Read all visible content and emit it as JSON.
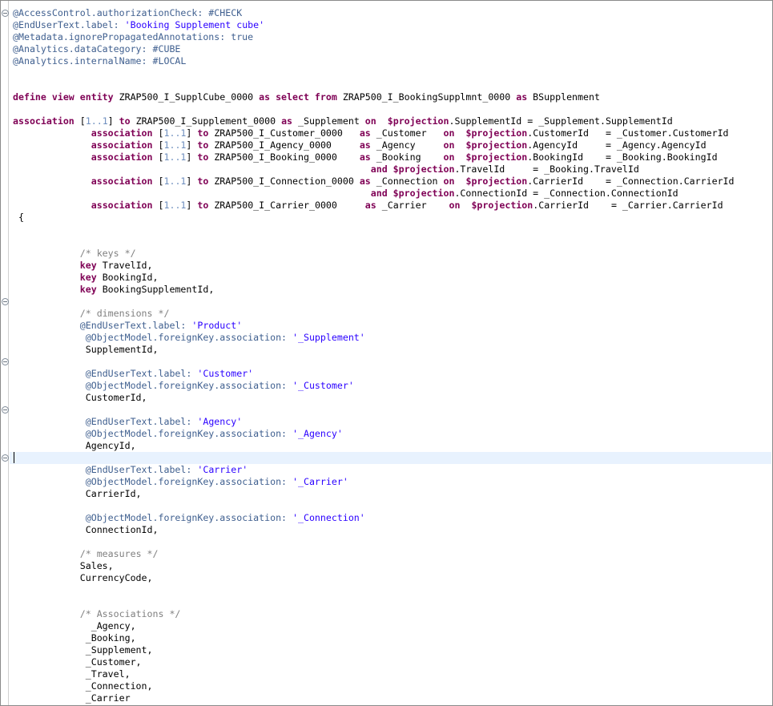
{
  "editor": {
    "language": "ABAP CDS",
    "cursor_line": 38,
    "fold_marker_lines": [
      1,
      25,
      30,
      34,
      38
    ],
    "lines": [
      [
        [
          "anno",
          "@AccessControl.authorizationCheck: #CHECK"
        ]
      ],
      [
        [
          "anno",
          "@EndUserText.label: "
        ],
        [
          "str",
          "'Booking Supplement cube'"
        ]
      ],
      [
        [
          "anno",
          "@Metadata.ignorePropagatedAnnotations: true"
        ]
      ],
      [
        [
          "anno",
          "@Analytics.dataCategory: #CUBE"
        ]
      ],
      [
        [
          "anno",
          "@Analytics.internalName: #LOCAL"
        ]
      ],
      [],
      [],
      [
        [
          "kw",
          "define view entity"
        ],
        [
          "plain",
          " ZRAP500_I_SupplCube_0000 "
        ],
        [
          "kw",
          "as select from"
        ],
        [
          "plain",
          " ZRAP500_I_BookingSupplmnt_0000 "
        ],
        [
          "kw",
          "as"
        ],
        [
          "plain",
          " BSupplenment"
        ]
      ],
      [],
      [
        [
          "kw",
          "association"
        ],
        [
          "plain",
          " ["
        ],
        [
          "num",
          "1..1"
        ],
        [
          "plain",
          "] "
        ],
        [
          "kw",
          "to"
        ],
        [
          "plain",
          " ZRAP500_I_Supplement_0000 "
        ],
        [
          "kw",
          "as"
        ],
        [
          "plain",
          " _Supplement "
        ],
        [
          "kw",
          "on"
        ],
        [
          "plain",
          "  "
        ],
        [
          "kw",
          "$projection"
        ],
        [
          "plain",
          ".SupplementId = _Supplement.SupplementId"
        ]
      ],
      [
        [
          "plain",
          "              "
        ],
        [
          "kw",
          "association"
        ],
        [
          "plain",
          " ["
        ],
        [
          "num",
          "1..1"
        ],
        [
          "plain",
          "] "
        ],
        [
          "kw",
          "to"
        ],
        [
          "plain",
          " ZRAP500_I_Customer_0000   "
        ],
        [
          "kw",
          "as"
        ],
        [
          "plain",
          " _Customer   "
        ],
        [
          "kw",
          "on"
        ],
        [
          "plain",
          "  "
        ],
        [
          "kw",
          "$projection"
        ],
        [
          "plain",
          ".CustomerId   = _Customer.CustomerId"
        ]
      ],
      [
        [
          "plain",
          "              "
        ],
        [
          "kw",
          "association"
        ],
        [
          "plain",
          " ["
        ],
        [
          "num",
          "1..1"
        ],
        [
          "plain",
          "] "
        ],
        [
          "kw",
          "to"
        ],
        [
          "plain",
          " ZRAP500_I_Agency_0000     "
        ],
        [
          "kw",
          "as"
        ],
        [
          "plain",
          " _Agency     "
        ],
        [
          "kw",
          "on"
        ],
        [
          "plain",
          "  "
        ],
        [
          "kw",
          "$projection"
        ],
        [
          "plain",
          ".AgencyId     = _Agency.AgencyId"
        ]
      ],
      [
        [
          "plain",
          "              "
        ],
        [
          "kw",
          "association"
        ],
        [
          "plain",
          " ["
        ],
        [
          "num",
          "1..1"
        ],
        [
          "plain",
          "] "
        ],
        [
          "kw",
          "to"
        ],
        [
          "plain",
          " ZRAP500_I_Booking_0000    "
        ],
        [
          "kw",
          "as"
        ],
        [
          "plain",
          " _Booking    "
        ],
        [
          "kw",
          "on"
        ],
        [
          "plain",
          "  "
        ],
        [
          "kw",
          "$projection"
        ],
        [
          "plain",
          ".BookingId    = _Booking.BookingId"
        ]
      ],
      [
        [
          "plain",
          "                                                                "
        ],
        [
          "kw",
          "and"
        ],
        [
          "plain",
          " "
        ],
        [
          "kw",
          "$projection"
        ],
        [
          "plain",
          ".TravelId     = _Booking.TravelId"
        ]
      ],
      [
        [
          "plain",
          "              "
        ],
        [
          "kw",
          "association"
        ],
        [
          "plain",
          " ["
        ],
        [
          "num",
          "1..1"
        ],
        [
          "plain",
          "] "
        ],
        [
          "kw",
          "to"
        ],
        [
          "plain",
          " ZRAP500_I_Connection_0000 "
        ],
        [
          "kw",
          "as"
        ],
        [
          "plain",
          " _Connection "
        ],
        [
          "kw",
          "on"
        ],
        [
          "plain",
          "  "
        ],
        [
          "kw",
          "$projection"
        ],
        [
          "plain",
          ".CarrierId    = _Connection.CarrierId"
        ]
      ],
      [
        [
          "plain",
          "                                                                "
        ],
        [
          "kw",
          "and"
        ],
        [
          "plain",
          " "
        ],
        [
          "kw",
          "$projection"
        ],
        [
          "plain",
          ".ConnectionId = _Connection.ConnectionId"
        ]
      ],
      [
        [
          "plain",
          "              "
        ],
        [
          "kw",
          "association"
        ],
        [
          "plain",
          " ["
        ],
        [
          "num",
          "1..1"
        ],
        [
          "plain",
          "] "
        ],
        [
          "kw",
          "to"
        ],
        [
          "plain",
          " ZRAP500_I_Carrier_0000     "
        ],
        [
          "kw",
          "as"
        ],
        [
          "plain",
          " _Carrier    "
        ],
        [
          "kw",
          "on"
        ],
        [
          "plain",
          "  "
        ],
        [
          "kw",
          "$projection"
        ],
        [
          "plain",
          ".CarrierId    = _Carrier.CarrierId"
        ]
      ],
      [
        [
          "plain",
          " {"
        ]
      ],
      [],
      [],
      [
        [
          "plain",
          "            "
        ],
        [
          "cmt",
          "/* keys */"
        ]
      ],
      [
        [
          "plain",
          "            "
        ],
        [
          "kw",
          "key"
        ],
        [
          "plain",
          " TravelId,"
        ]
      ],
      [
        [
          "plain",
          "            "
        ],
        [
          "kw",
          "key"
        ],
        [
          "plain",
          " BookingId,"
        ]
      ],
      [
        [
          "plain",
          "            "
        ],
        [
          "kw",
          "key"
        ],
        [
          "plain",
          " BookingSupplementId,"
        ]
      ],
      [],
      [
        [
          "plain",
          "            "
        ],
        [
          "cmt",
          "/* dimensions */"
        ]
      ],
      [
        [
          "plain",
          "            "
        ],
        [
          "anno",
          "@EndUserText.label: "
        ],
        [
          "str",
          "'Product'"
        ]
      ],
      [
        [
          "plain",
          "             "
        ],
        [
          "anno",
          "@ObjectModel.foreignKey.association: "
        ],
        [
          "str",
          "'_Supplement'"
        ]
      ],
      [
        [
          "plain",
          "             SupplementId,"
        ]
      ],
      [],
      [
        [
          "plain",
          "             "
        ],
        [
          "anno",
          "@EndUserText.label: "
        ],
        [
          "str",
          "'Customer'"
        ]
      ],
      [
        [
          "plain",
          "             "
        ],
        [
          "anno",
          "@ObjectModel.foreignKey.association: "
        ],
        [
          "str",
          "'_Customer'"
        ]
      ],
      [
        [
          "plain",
          "             CustomerId,"
        ]
      ],
      [],
      [
        [
          "plain",
          "             "
        ],
        [
          "anno",
          "@EndUserText.label: "
        ],
        [
          "str",
          "'Agency'"
        ]
      ],
      [
        [
          "plain",
          "             "
        ],
        [
          "anno",
          "@ObjectModel.foreignKey.association: "
        ],
        [
          "str",
          "'_Agency'"
        ]
      ],
      [
        [
          "plain",
          "             AgencyId,"
        ]
      ],
      [],
      [
        [
          "plain",
          "             "
        ],
        [
          "anno",
          "@EndUserText.label: "
        ],
        [
          "str",
          "'Carrier'"
        ]
      ],
      [
        [
          "plain",
          "             "
        ],
        [
          "anno",
          "@ObjectModel.foreignKey.association: "
        ],
        [
          "str",
          "'_Carrier'"
        ]
      ],
      [
        [
          "plain",
          "             CarrierId,"
        ]
      ],
      [],
      [
        [
          "plain",
          "             "
        ],
        [
          "anno",
          "@ObjectModel.foreignKey.association: "
        ],
        [
          "str",
          "'_Connection'"
        ]
      ],
      [
        [
          "plain",
          "             ConnectionId,"
        ]
      ],
      [],
      [
        [
          "plain",
          "            "
        ],
        [
          "cmt",
          "/* measures */"
        ]
      ],
      [
        [
          "plain",
          "            "
        ],
        [
          "squiggle",
          "Sales"
        ],
        [
          "plain",
          ","
        ]
      ],
      [
        [
          "plain",
          "            CurrencyCode,"
        ]
      ],
      [],
      [],
      [
        [
          "plain",
          "            "
        ],
        [
          "cmt",
          "/* Associations */"
        ]
      ],
      [
        [
          "plain",
          "              _Agency,"
        ]
      ],
      [
        [
          "plain",
          "             _Booking,"
        ]
      ],
      [
        [
          "plain",
          "             _Supplement,"
        ]
      ],
      [
        [
          "plain",
          "             _Customer,"
        ]
      ],
      [
        [
          "plain",
          "             _Travel,"
        ]
      ],
      [
        [
          "plain",
          "             _Connection,"
        ]
      ],
      [
        [
          "plain",
          "             _Carrier"
        ]
      ]
    ]
  }
}
